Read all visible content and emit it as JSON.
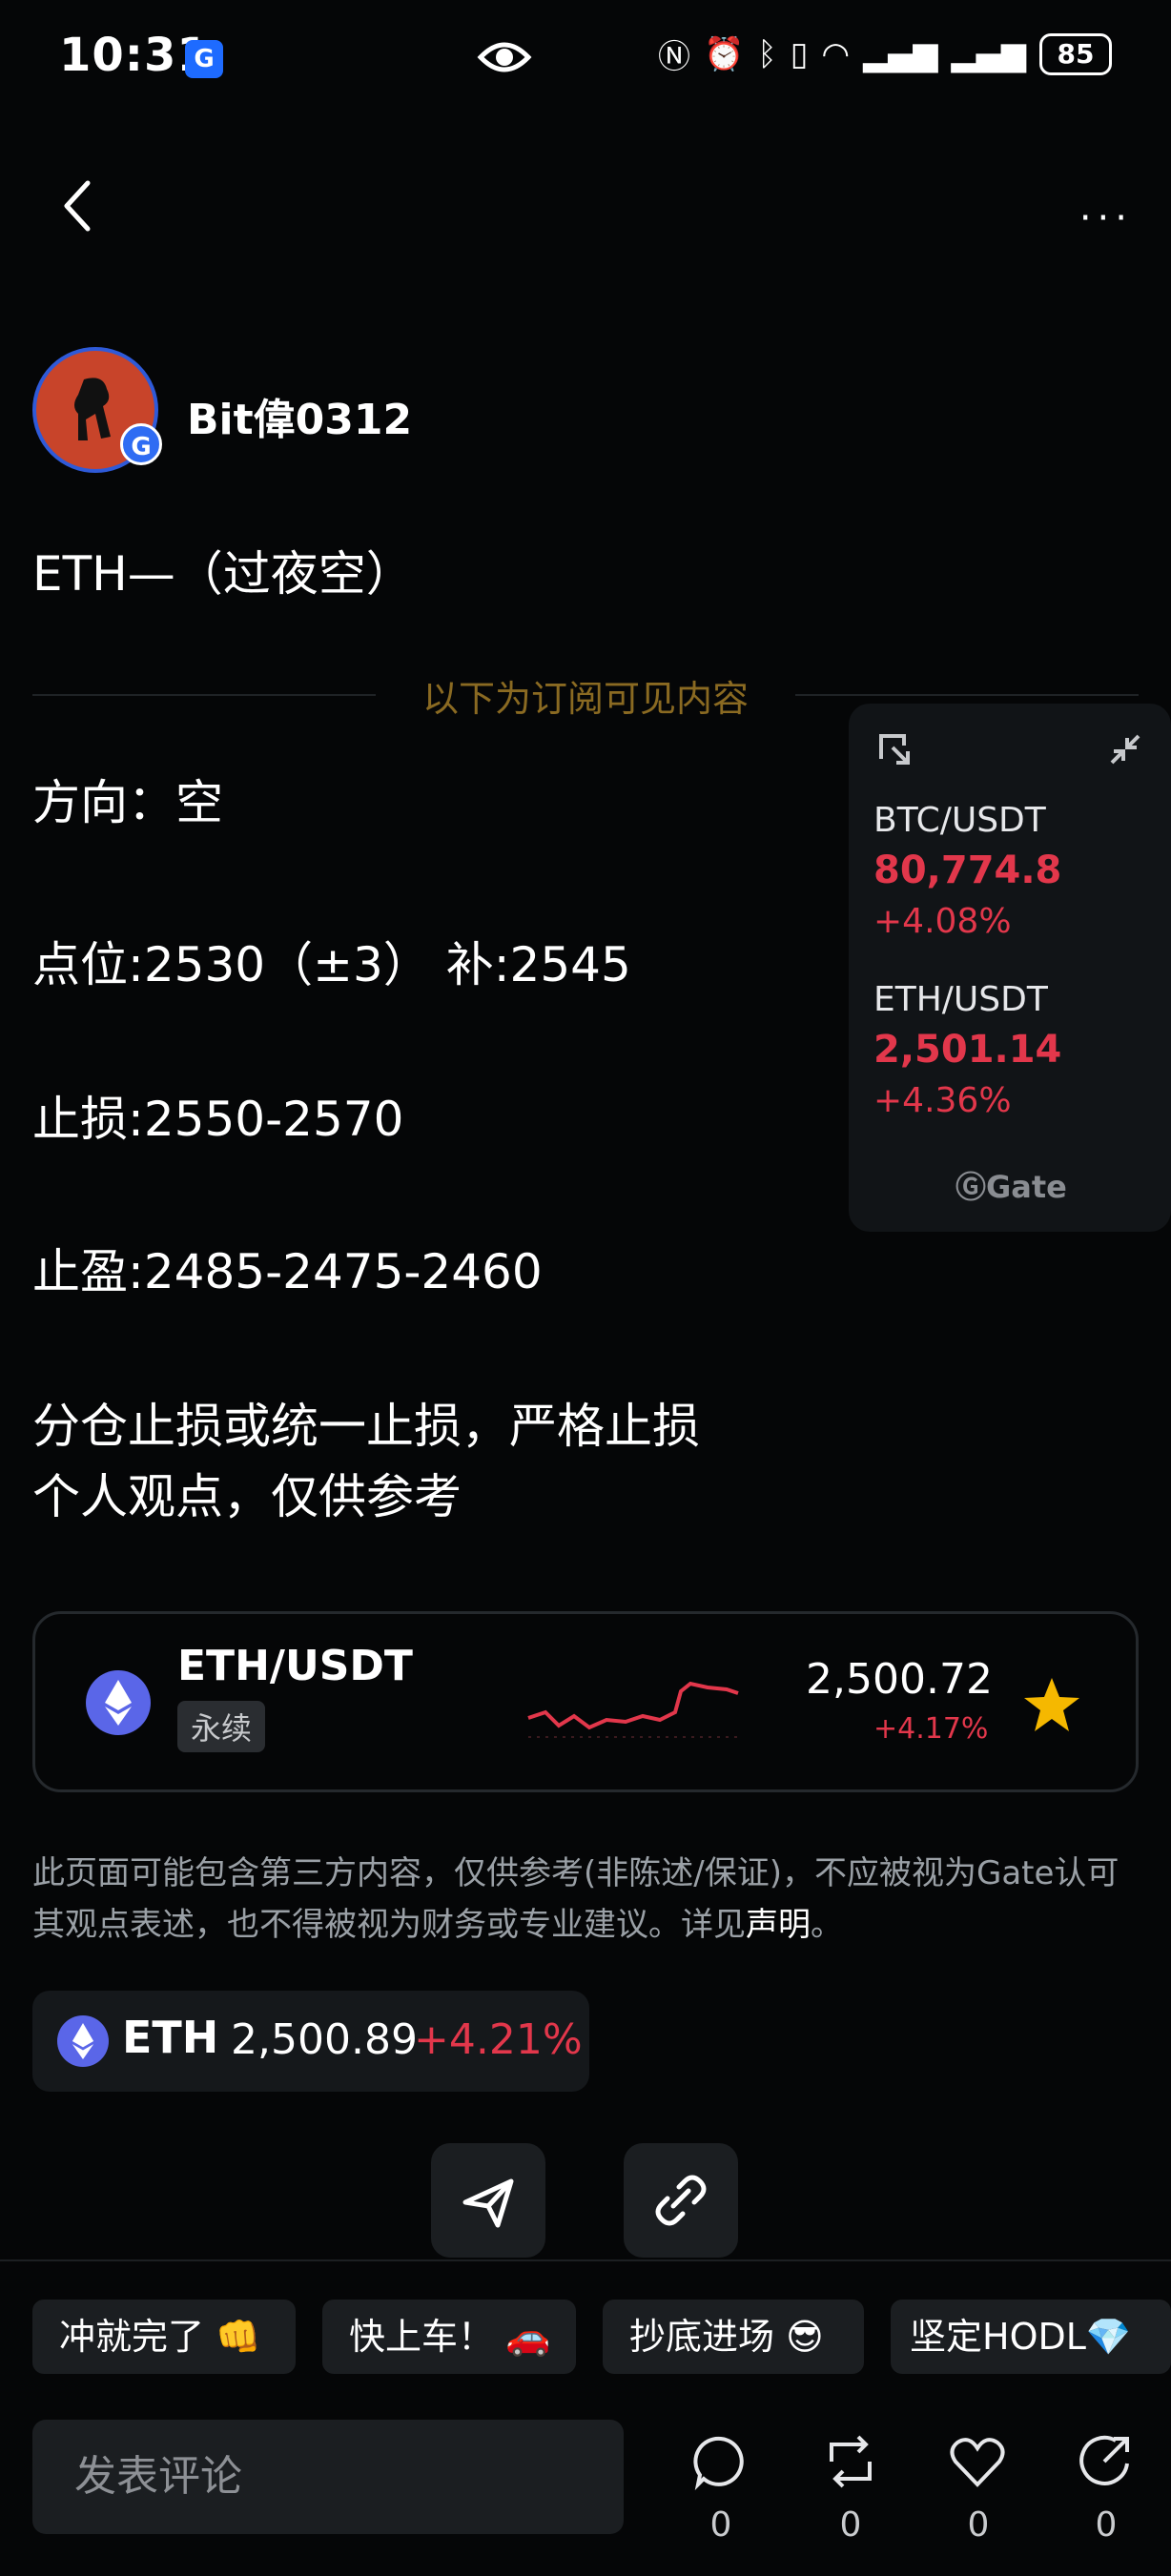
{
  "status_bar": {
    "time": "10:31",
    "battery": "85",
    "app_badge": "G"
  },
  "nav": {
    "more": "···"
  },
  "author": {
    "name": "Bit偉0312",
    "avatar_badge": "G"
  },
  "post": {
    "title": "ETH—（过夜空）",
    "subscription_divider": "以下为订阅可见内容",
    "lines": [
      "方向：空",
      "点位:2530（±3） 补:2545",
      "止损:2550-2570",
      "止盈:2485-2475-2460",
      " 分仓止损或统一止损，严格止损",
      "个人观点，仅供参考"
    ]
  },
  "widget": {
    "tickers": [
      {
        "pair": "BTC/USDT",
        "price": "80,774.8",
        "change": "+4.08%"
      },
      {
        "pair": "ETH/USDT",
        "price": "2,501.14",
        "change": "+4.36%"
      }
    ],
    "brand": "Gate"
  },
  "market_card": {
    "pair": "ETH/USDT",
    "tag": "永续",
    "price": "2,500.72",
    "change": "+4.17%"
  },
  "disclaimer": {
    "text": "此页面可能包含第三方内容，仅供参考(非陈述/保证)，不应被视为Gate认可其观点表述，也不得被视为财务或专业建议。详见",
    "link": "声明",
    "end": "。"
  },
  "coin_pill": {
    "symbol": "ETH",
    "price": "2,500.89",
    "change": "+4.21%"
  },
  "quick_replies": [
    "冲就完了 👊",
    "快上车！ 🚗",
    "抄底进场 😎",
    "坚定HODL💎"
  ],
  "comment": {
    "placeholder": "发表评论"
  },
  "stats": {
    "comments": "0",
    "reposts": "0",
    "likes": "0",
    "shares": "0"
  },
  "colors": {
    "up": "#e2374b",
    "accent_gold": "#8a6a22",
    "background": "#050607"
  },
  "icons": [
    "eye-icon",
    "back-arrow-icon",
    "more-icon",
    "expand-icon",
    "collapse-icon",
    "star-icon",
    "share-send-icon",
    "link-icon",
    "comment-icon",
    "repost-icon",
    "heart-icon",
    "share-icon"
  ]
}
